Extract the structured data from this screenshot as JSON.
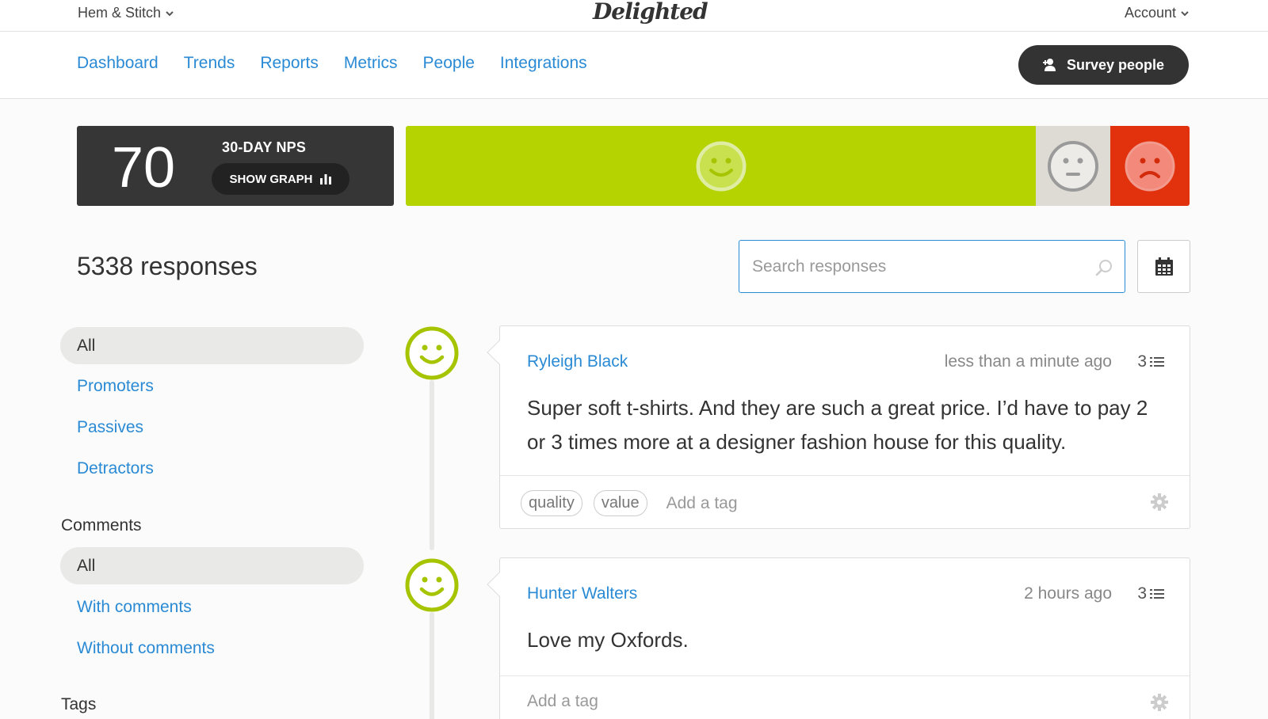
{
  "topbar": {
    "company": "Hem & Stitch",
    "logo": "Delighted",
    "account": "Account"
  },
  "nav": {
    "links": [
      "Dashboard",
      "Trends",
      "Reports",
      "Metrics",
      "People",
      "Integrations"
    ],
    "survey_button": "Survey people"
  },
  "nps": {
    "score": "70",
    "label": "30-DAY NPS",
    "show_graph": "SHOW GRAPH",
    "promoters_share": 0.795,
    "passives_share": 0.094,
    "detractors_share": 0.1,
    "colors": {
      "promoters": "#b4d300",
      "passives": "#dedbd4",
      "detractors": "#e2310d"
    }
  },
  "responses": {
    "count_text": "5338 responses",
    "search_placeholder": "Search responses"
  },
  "sidebar": {
    "filters": [
      "All",
      "Promoters",
      "Passives",
      "Detractors"
    ],
    "comments_heading": "Comments",
    "comments": [
      "All",
      "With comments",
      "Without comments"
    ],
    "tags_heading": "Tags"
  },
  "cards": [
    {
      "name": "Ryleigh Black",
      "time": "less than a minute ago",
      "score": "3",
      "text": "Super soft t-shirts. And they are such a great price. I’d have to pay 2 or 3 times more at a designer fashion house for this quality.",
      "tags": [
        "quality",
        "value"
      ],
      "add_tag": "Add a tag"
    },
    {
      "name": "Hunter Walters",
      "time": "2 hours ago",
      "score": "3",
      "text": "Love my Oxfords.",
      "tags": [],
      "add_tag": "Add a tag"
    }
  ],
  "colors": {
    "accent": "#2a8ad4",
    "dark": "#333333",
    "promoter_face": "#a6c400"
  }
}
